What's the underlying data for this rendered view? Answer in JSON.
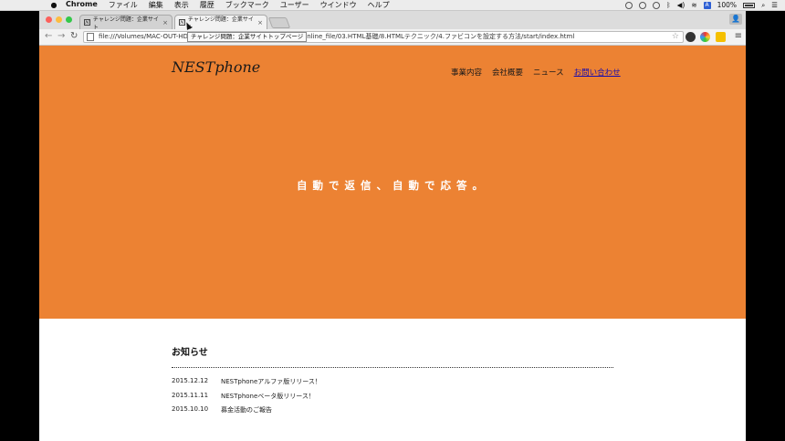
{
  "menubar": {
    "apple": "",
    "app": "Chrome",
    "items": [
      "ファイル",
      "編集",
      "表示",
      "履歴",
      "ブックマーク",
      "ユーザー",
      "ウインドウ",
      "ヘルプ"
    ],
    "battery": "100%",
    "input_source": "A"
  },
  "browser": {
    "tabs": [
      {
        "favicon": "N",
        "title": "チャレンジ問題：企業サイト",
        "close": "×"
      },
      {
        "favicon": "N",
        "title": "チャレンジ問題：企業サイト",
        "close": "×"
      }
    ],
    "url": "file:///Volumes/MAC-OUT-HD",
    "url_rest": "online_file/03.HTML基礎/8.HTMLテクニック/4.ファビコンを設定する方法/start/index.html",
    "tooltip": "チャレンジ問題：企業サイトトップページ"
  },
  "site": {
    "logo": "NESTphone",
    "nav": [
      "事業内容",
      "会社概要",
      "ニュース",
      "お問い合わせ"
    ],
    "tagline": "自動で返信、自動で応答。",
    "news_heading": "お知らせ",
    "news": [
      {
        "date": "2015.12.12",
        "title": "NESTphoneアルファ版リリース！"
      },
      {
        "date": "2015.11.11",
        "title": "NESTphoneベータ版リリース！"
      },
      {
        "date": "2015.10.10",
        "title": "募金活動のご報告"
      }
    ]
  },
  "colors": {
    "hero": "#ec8233",
    "link": "#1a0dab"
  }
}
